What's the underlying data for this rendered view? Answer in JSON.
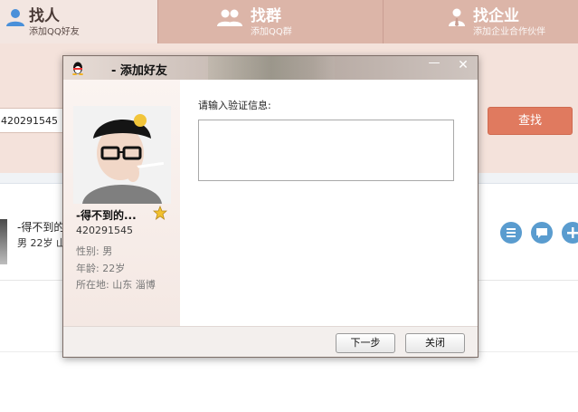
{
  "tabs": [
    {
      "label": "找人",
      "sub": "添加QQ好友",
      "icon": "person-icon"
    },
    {
      "label": "找群",
      "sub": "添加QQ群",
      "icon": "group-icon"
    },
    {
      "label": "找企业",
      "sub": "添加企业合作伙伴",
      "icon": "company-icon"
    }
  ],
  "search": {
    "value": "420291545",
    "button_label": "查找"
  },
  "result": {
    "name": "-得不到的",
    "info": "男 22岁 山",
    "actions": [
      "detail-icon",
      "chat-icon",
      "add-icon"
    ]
  },
  "dialog": {
    "title": "- 添加好友",
    "minimize": "—",
    "close": "✕",
    "profile": {
      "name": "-得不到的...",
      "qq": "420291545",
      "gender": "性别: 男",
      "age": "年龄: 22岁",
      "location": "所在地: 山东  淄博"
    },
    "prompt": "请输入验证信息:",
    "message_value": "",
    "buttons": {
      "next": "下一步",
      "close": "关闭"
    }
  },
  "colors": {
    "accent": "#e07a5f",
    "tabbar": "#dcb5a8",
    "action_blue": "#5a9ccf"
  }
}
